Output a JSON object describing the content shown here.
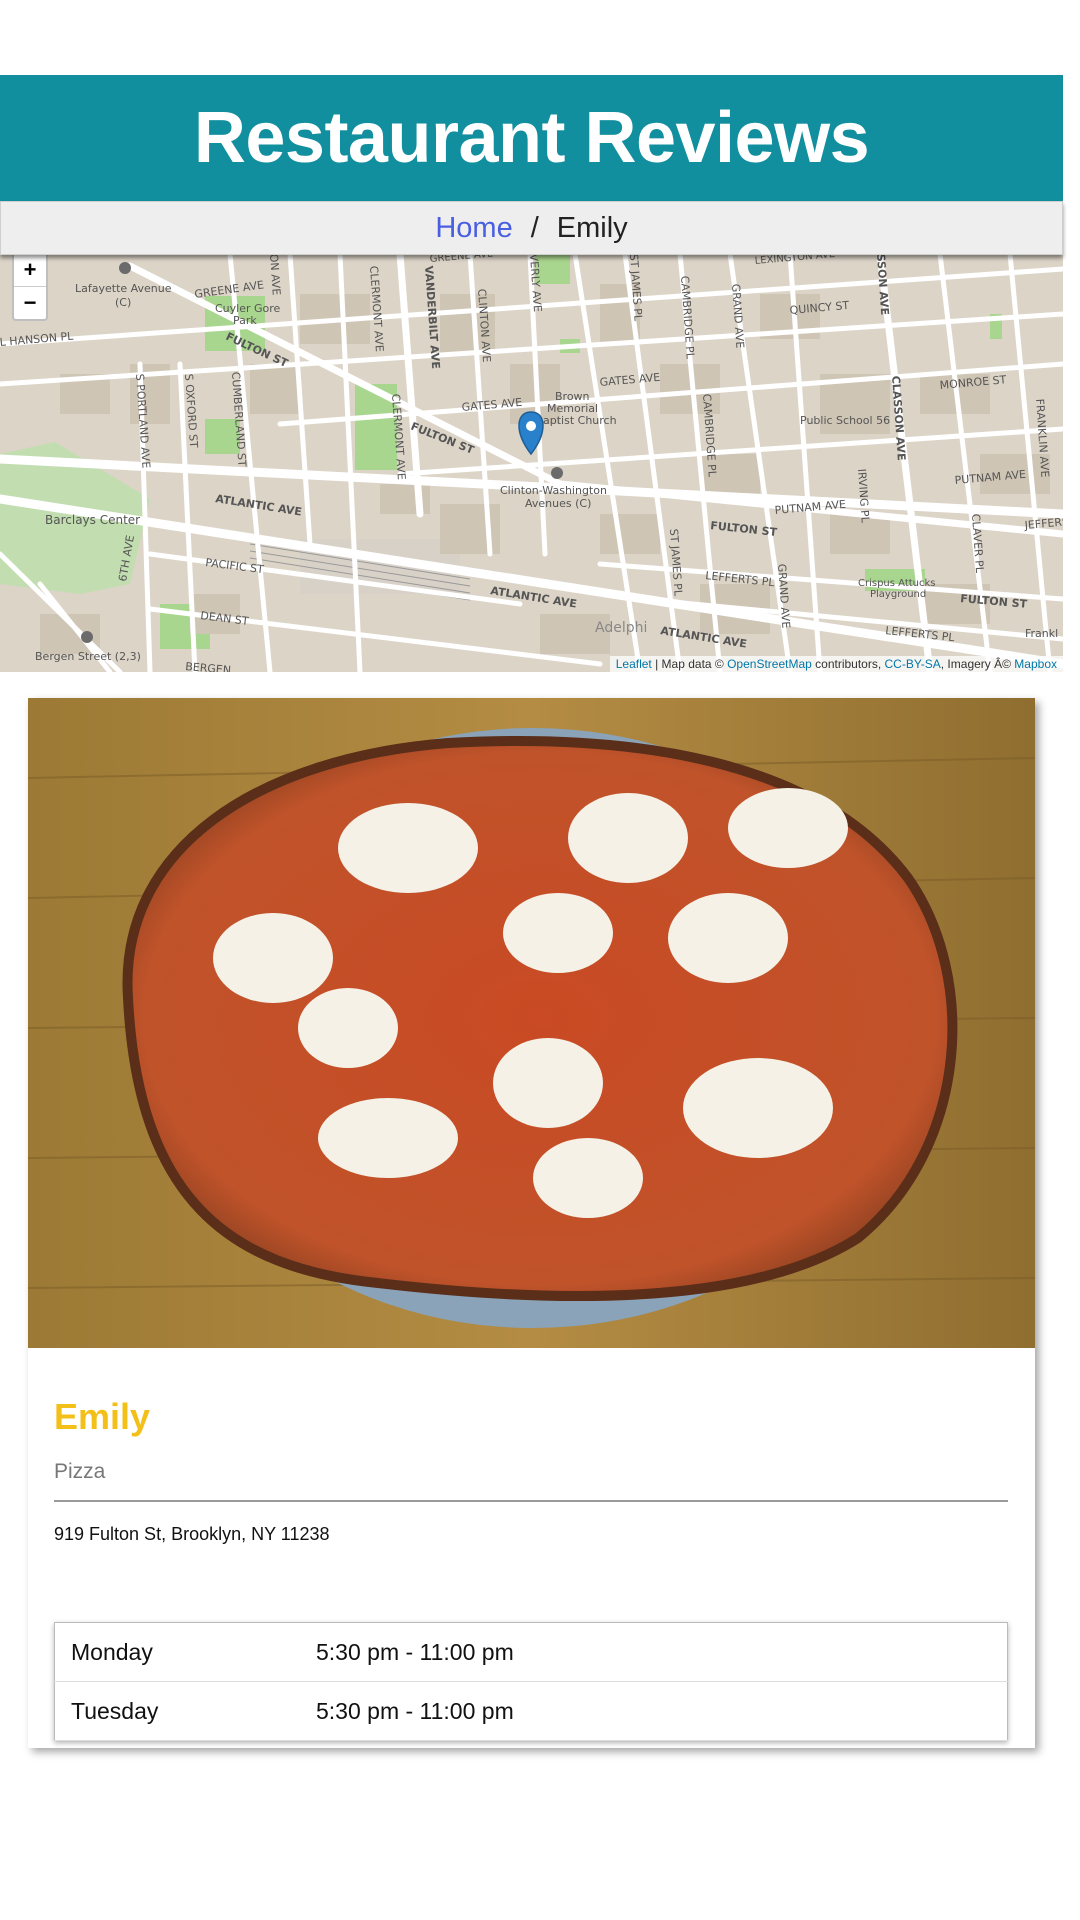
{
  "header": {
    "title": "Restaurant Reviews"
  },
  "breadcrumb": {
    "home": "Home",
    "separator": "/",
    "current": "Emily"
  },
  "map": {
    "zoom_in": "+",
    "zoom_out": "−",
    "labels": {
      "lafayette_1": "Lafayette Avenue",
      "lafayette_2": "(C)",
      "greene_ave": "GREENE AVE",
      "greene_ave_top": "GREENE AVE",
      "cuyler_1": "Cuyler Gore",
      "cuyler_2": "Park",
      "hanson": "L HANSON PL",
      "fulton_1": "FULTON ST",
      "fulton_2": "FULTON ST",
      "fulton_3": "FULTON ST",
      "fulton_4": "FULTON ST",
      "lexington": "LEXINGTON AVE",
      "quincy": "QUINCY ST",
      "monroe": "MONROE ST",
      "gates_1": "GATES AVE",
      "gates_2": "GATES AVE",
      "brown_1": "Brown",
      "brown_2": "Memorial",
      "brown_3": "aptist Church",
      "ps56": "Public School 56",
      "clinton_wash_1": "Clinton-Washington",
      "clinton_wash_2": "Avenues (C)",
      "atlantic_1": "ATLANTIC AVE",
      "atlantic_2": "ATLANTIC AVE",
      "atlantic_3": "ATLANTIC AVE",
      "putnam_1": "PUTNAM AVE",
      "putnam_2": "PUTNAM AVE",
      "jefferson": "JEFFERS",
      "barclays": "Barclays Center",
      "pacific": "PACIFIC ST",
      "dean": "DEAN ST",
      "lefferts_1": "LEFFERTS PL",
      "lefferts_2": "LEFFERTS PL",
      "crispus_1": "Crispus Attucks",
      "crispus_2": "Playground",
      "adelphi": "Adelphi",
      "bergen_station": "Bergen Street (2,3)",
      "bergen": "BERGEN",
      "franklin": "Frankl",
      "portland": "S PORTLAND AVE",
      "oxford": "S OXFORD ST",
      "cumberland": "CUMBERLAND ST",
      "clermont_1": "CLERMONT AVE",
      "clermont_2": "CLERMONT AVE",
      "vanderbilt": "VANDERBILT AVE",
      "clinton": "CLINTON AVE",
      "waverly": "VERLY AVE",
      "stjames_1": "ST JAMES PL",
      "stjames_2": "ST JAMES PL",
      "cambridge_1": "CAMBRIDGE PL",
      "cambridge_2": "CAMBRIDGE PL",
      "grand_1": "GRAND AVE",
      "grand_2": "GRAND AVE",
      "classon_1": "SSON AVE",
      "classon_2": "CLASSON AVE",
      "irving": "IRVING PL",
      "claver": "CLAVER PL",
      "franklin_ave": "FRANKLIN AVE",
      "sixth": "6TH AVE",
      "on_ave": "ON AVE"
    },
    "attribution": {
      "leaflet": "Leaflet",
      "text1": " | Map data © ",
      "osm": "OpenStreetMap",
      "text2": " contributors, ",
      "license": "CC-BY-SA",
      "text3": ", Imagery Â© ",
      "mapbox": "Mapbox"
    }
  },
  "restaurant": {
    "name": "Emily",
    "cuisine": "Pizza",
    "address": "919 Fulton St, Brooklyn, NY 11238",
    "hours": [
      {
        "day": "Monday",
        "time": "5:30 pm - 11:00 pm"
      },
      {
        "day": "Tuesday",
        "time": "5:30 pm - 11:00 pm"
      }
    ]
  },
  "colors": {
    "header_bg": "#128f9e",
    "link": "#4a5fe0",
    "restaurant_name": "#f3c01a",
    "map_marker": "#2a81cb"
  }
}
